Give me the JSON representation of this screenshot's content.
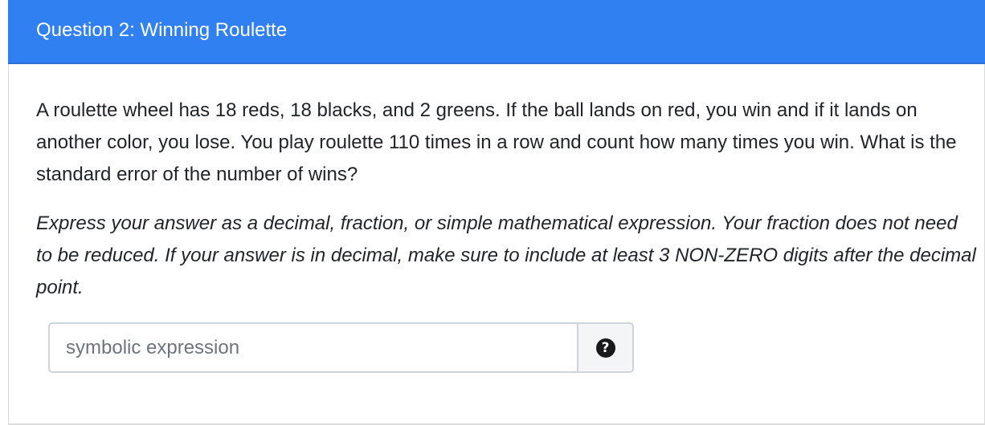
{
  "question": {
    "title": "Question 2: Winning Roulette",
    "body": "A roulette wheel has 18 reds, 18 blacks, and 2 greens. If the ball lands on red, you win and if it lands on another color, you lose. You play roulette 110 times in a row and count how many times you win. What is the standard error of the number of wins?",
    "instructions": "Express your answer as a decimal, fraction, or simple mathematical expression. Your fraction does not need to be reduced. If your answer is in decimal, make sure to include at least 3 NON-ZERO digits after the decimal point."
  },
  "answer": {
    "placeholder": "symbolic expression",
    "value": "",
    "help_icon": "question-circle-icon",
    "help_glyph": "?"
  },
  "colors": {
    "header_bg": "#3180f2",
    "header_text": "#ffffff",
    "body_text": "#212529"
  }
}
